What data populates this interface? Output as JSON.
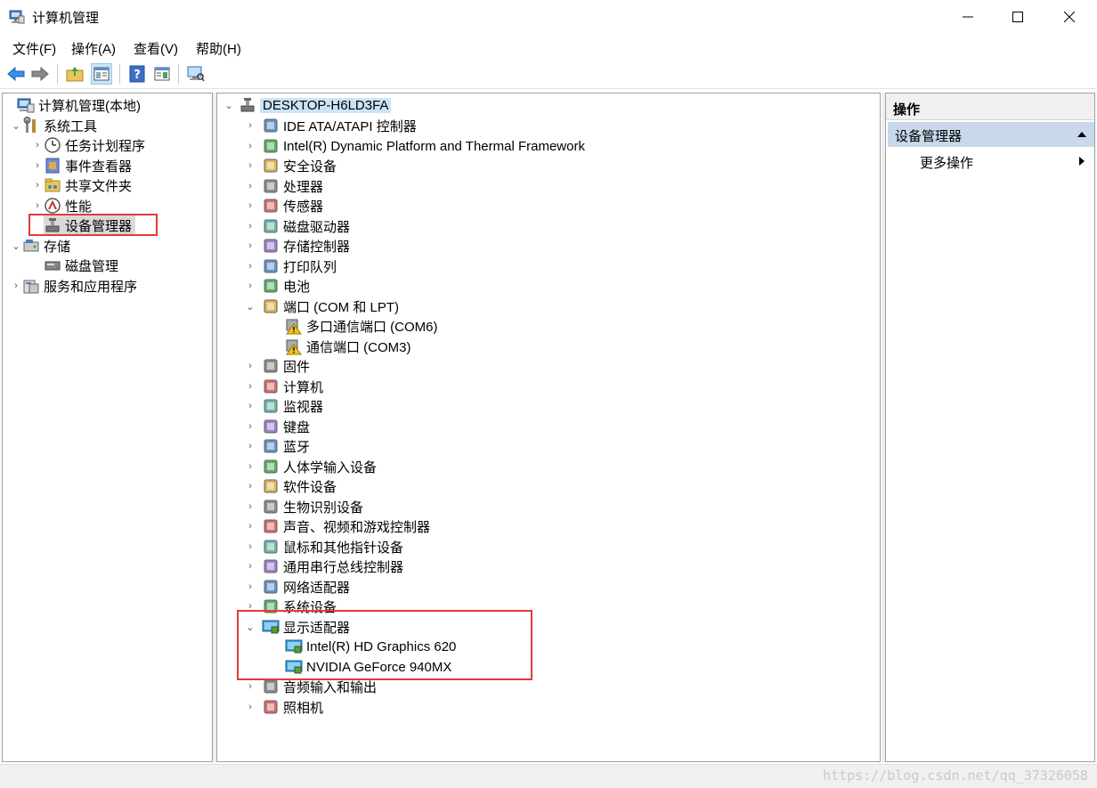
{
  "window": {
    "title": "计算机管理",
    "icon": "computer-management-icon"
  },
  "menu": [
    "文件(F)",
    "操作(A)",
    "查看(V)",
    "帮助(H)"
  ],
  "toolbar": [
    "back-arrow-icon",
    "forward-arrow-icon",
    "up-folder-icon",
    "show-hide-tree-icon",
    "help-icon",
    "properties-icon",
    "scan-hardware-icon"
  ],
  "left_tree": {
    "root": "计算机管理(本地)",
    "system_tools": "系统工具",
    "task_scheduler": "任务计划程序",
    "event_viewer": "事件查看器",
    "shared_folders": "共享文件夹",
    "performance": "性能",
    "device_manager": "设备管理器",
    "storage": "存储",
    "disk_management": "磁盘管理",
    "services": "服务和应用程序"
  },
  "device_tree": {
    "computer": "DESKTOP-H6LD3FA",
    "categories": [
      {
        "label": "IDE ATA/ATAPI 控制器",
        "icon": "ide-controller-icon"
      },
      {
        "label": "Intel(R) Dynamic Platform and Thermal Framework",
        "icon": "thermal-framework-icon"
      },
      {
        "label": "安全设备",
        "icon": "security-device-icon"
      },
      {
        "label": "处理器",
        "icon": "processor-icon"
      },
      {
        "label": "传感器",
        "icon": "sensor-icon"
      },
      {
        "label": "磁盘驱动器",
        "icon": "disk-drive-icon"
      },
      {
        "label": "存储控制器",
        "icon": "storage-controller-icon"
      },
      {
        "label": "打印队列",
        "icon": "printer-icon"
      },
      {
        "label": "电池",
        "icon": "battery-icon"
      },
      {
        "label": "端口 (COM 和 LPT)",
        "icon": "port-icon"
      },
      {
        "label": "固件",
        "icon": "firmware-icon"
      },
      {
        "label": "计算机",
        "icon": "computer-icon"
      },
      {
        "label": "监视器",
        "icon": "monitor-icon"
      },
      {
        "label": "键盘",
        "icon": "keyboard-icon"
      },
      {
        "label": "蓝牙",
        "icon": "bluetooth-icon"
      },
      {
        "label": "人体学输入设备",
        "icon": "hid-icon"
      },
      {
        "label": "软件设备",
        "icon": "software-device-icon"
      },
      {
        "label": "生物识别设备",
        "icon": "biometric-icon"
      },
      {
        "label": "声音、视频和游戏控制器",
        "icon": "sound-icon"
      },
      {
        "label": "鼠标和其他指针设备",
        "icon": "mouse-icon"
      },
      {
        "label": "通用串行总线控制器",
        "icon": "usb-icon"
      },
      {
        "label": "网络适配器",
        "icon": "network-adapter-icon"
      },
      {
        "label": "系统设备",
        "icon": "system-device-icon"
      },
      {
        "label": "显示适配器",
        "icon": "display-adapter-icon"
      },
      {
        "label": "音频输入和输出",
        "icon": "audio-io-icon"
      },
      {
        "label": "照相机",
        "icon": "camera-icon"
      }
    ],
    "ports": [
      "多口通信端口 (COM6)",
      "通信端口 (COM3)"
    ],
    "display_adapters": [
      "Intel(R) HD Graphics 620",
      "NVIDIA GeForce 940MX"
    ]
  },
  "actions": {
    "header": "操作",
    "group": "设备管理器",
    "more": "更多操作"
  },
  "watermark": "https://blog.csdn.net/qq_37326058",
  "colors": {
    "highlight": "#e53a3a",
    "selection": "#cce4f7",
    "action_group": "#c9d8ea"
  }
}
